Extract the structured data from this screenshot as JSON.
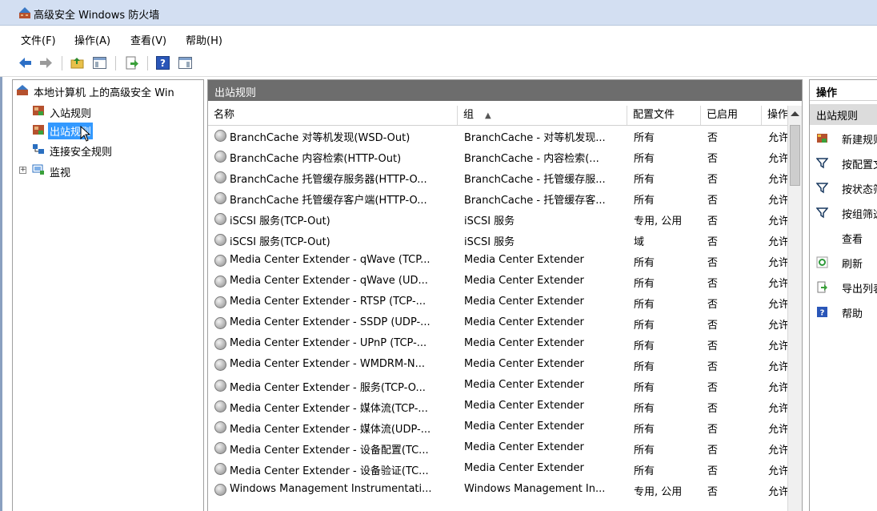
{
  "window": {
    "title": "高级安全 Windows 防火墙"
  },
  "menu": [
    {
      "label": "文件(F)"
    },
    {
      "label": "操作(A)"
    },
    {
      "label": "查看(V)"
    },
    {
      "label": "帮助(H)"
    }
  ],
  "tree": {
    "root": "本地计算机 上的高级安全 Win",
    "items": [
      {
        "label": "入站规则"
      },
      {
        "label": "出站规则"
      },
      {
        "label": "连接安全规则"
      },
      {
        "label": "监视"
      }
    ]
  },
  "center": {
    "title": "出站规则",
    "columns": [
      "名称",
      "组",
      "配置文件",
      "已启用",
      "操作"
    ],
    "sort_indicator": "▲",
    "rows": [
      {
        "name": "BranchCache 对等机发现(WSD-Out)",
        "group": "BranchCache - 对等机发现...",
        "profile": "所有",
        "enabled": "否",
        "action": "允许"
      },
      {
        "name": "BranchCache 内容检索(HTTP-Out)",
        "group": "BranchCache - 内容检索(...",
        "profile": "所有",
        "enabled": "否",
        "action": "允许"
      },
      {
        "name": "BranchCache 托管缓存服务器(HTTP-O...",
        "group": "BranchCache - 托管缓存服...",
        "profile": "所有",
        "enabled": "否",
        "action": "允许"
      },
      {
        "name": "BranchCache 托管缓存客户端(HTTP-O...",
        "group": "BranchCache - 托管缓存客...",
        "profile": "所有",
        "enabled": "否",
        "action": "允许"
      },
      {
        "name": "iSCSI 服务(TCP-Out)",
        "group": "iSCSI 服务",
        "profile": "专用, 公用",
        "enabled": "否",
        "action": "允许"
      },
      {
        "name": "iSCSI 服务(TCP-Out)",
        "group": "iSCSI 服务",
        "profile": "域",
        "enabled": "否",
        "action": "允许"
      },
      {
        "name": "Media Center Extender - qWave (TCP...",
        "group": "Media Center Extender",
        "profile": "所有",
        "enabled": "否",
        "action": "允许"
      },
      {
        "name": "Media Center Extender - qWave (UD...",
        "group": "Media Center Extender",
        "profile": "所有",
        "enabled": "否",
        "action": "允许"
      },
      {
        "name": "Media Center Extender - RTSP (TCP-...",
        "group": "Media Center Extender",
        "profile": "所有",
        "enabled": "否",
        "action": "允许"
      },
      {
        "name": "Media Center Extender - SSDP (UDP-...",
        "group": "Media Center Extender",
        "profile": "所有",
        "enabled": "否",
        "action": "允许"
      },
      {
        "name": "Media Center Extender - UPnP (TCP-...",
        "group": "Media Center Extender",
        "profile": "所有",
        "enabled": "否",
        "action": "允许"
      },
      {
        "name": "Media Center Extender - WMDRM-N...",
        "group": "Media Center Extender",
        "profile": "所有",
        "enabled": "否",
        "action": "允许"
      },
      {
        "name": "Media Center Extender - 服务(TCP-O...",
        "group": "Media Center Extender",
        "profile": "所有",
        "enabled": "否",
        "action": "允许"
      },
      {
        "name": "Media Center Extender - 媒体流(TCP-...",
        "group": "Media Center Extender",
        "profile": "所有",
        "enabled": "否",
        "action": "允许"
      },
      {
        "name": "Media Center Extender - 媒体流(UDP-...",
        "group": "Media Center Extender",
        "profile": "所有",
        "enabled": "否",
        "action": "允许"
      },
      {
        "name": "Media Center Extender - 设备配置(TC...",
        "group": "Media Center Extender",
        "profile": "所有",
        "enabled": "否",
        "action": "允许"
      },
      {
        "name": "Media Center Extender - 设备验证(TC...",
        "group": "Media Center Extender",
        "profile": "所有",
        "enabled": "否",
        "action": "允许"
      },
      {
        "name": "Windows Management Instrumentati...",
        "group": "Windows Management In...",
        "profile": "专用, 公用",
        "enabled": "否",
        "action": "允许"
      }
    ]
  },
  "actions": {
    "title": "操作",
    "section": "出站规则",
    "items": [
      {
        "label": "新建规则...",
        "icon": "new-rule-icon"
      },
      {
        "label": "按配置文件筛选",
        "icon": "filter-icon"
      },
      {
        "label": "按状态筛选",
        "icon": "filter-icon"
      },
      {
        "label": "按组筛选",
        "icon": "filter-icon"
      },
      {
        "label": "查看",
        "icon": ""
      },
      {
        "label": "刷新",
        "icon": "refresh-icon"
      },
      {
        "label": "导出列表...",
        "icon": "export-icon"
      },
      {
        "label": "帮助",
        "icon": "help-icon"
      }
    ]
  }
}
